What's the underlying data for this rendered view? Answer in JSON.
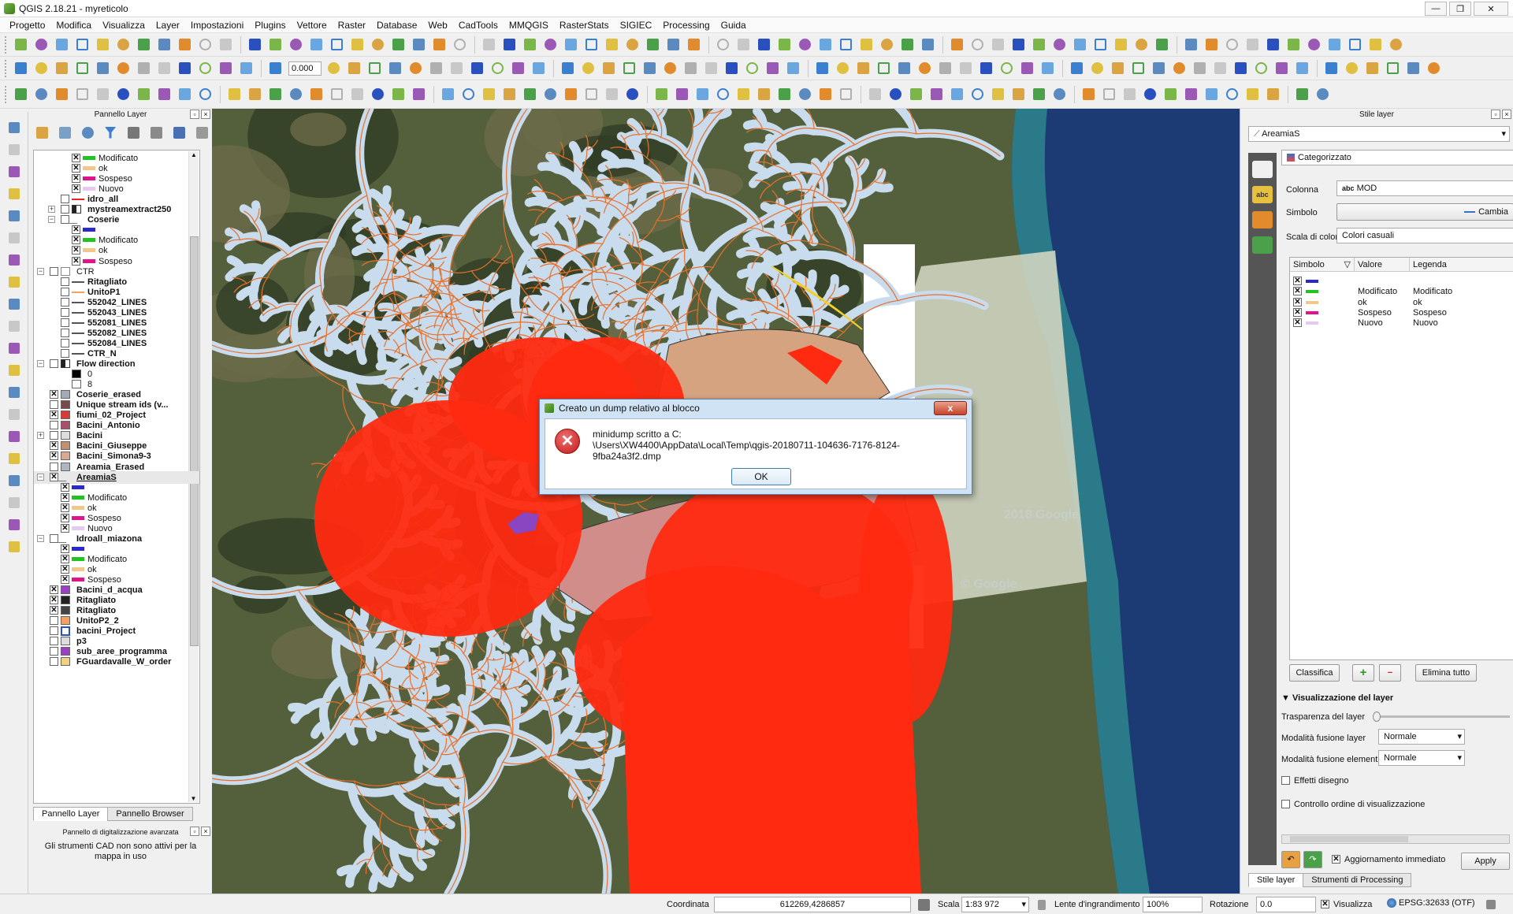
{
  "window": {
    "title": "QGIS 2.18.21 - myreticolo",
    "min": "—",
    "max": "❐",
    "close": "✕"
  },
  "menu": [
    "Progetto",
    "Modifica",
    "Visualizza",
    "Layer",
    "Impostazioni",
    "Plugins",
    "Vettore",
    "Raster",
    "Database",
    "Web",
    "CadTools",
    "MMQGIS",
    "RasterStats",
    "SIGIEC",
    "Processing",
    "Guida"
  ],
  "toolbar": {
    "stroke_value": "0.000"
  },
  "layer_panel": {
    "title": "Pannello Layer",
    "tabs": [
      "Pannello Layer",
      "Pannello Browser"
    ]
  },
  "layers": [
    {
      "level": 2,
      "cb": true,
      "sym": "#22c222",
      "name": "Modificato",
      "cls": true
    },
    {
      "level": 2,
      "cb": true,
      "sym": "#f2c88a",
      "name": "ok",
      "cls": true
    },
    {
      "level": 2,
      "cb": true,
      "sym": "#e0158a",
      "name": "Sospeso",
      "cls": true
    },
    {
      "level": 2,
      "cb": true,
      "sym": "#e6c9f0",
      "name": "Nuovo",
      "cls": true
    },
    {
      "level": 1,
      "cb": false,
      "sym": "#ee2222",
      "name": "idro_all"
    },
    {
      "level": 1,
      "exp": "+",
      "cb": false,
      "sym": "raster",
      "name": "mystreamextract250"
    },
    {
      "level": 1,
      "exp": "−",
      "cb": false,
      "sym": "line",
      "name": "Coserie"
    },
    {
      "level": 2,
      "cb": true,
      "sym": "#2a2acc",
      "name": "",
      "cls": true
    },
    {
      "level": 2,
      "cb": true,
      "sym": "#22c222",
      "name": "Modificato",
      "cls": true
    },
    {
      "level": 2,
      "cb": true,
      "sym": "#f2c88a",
      "name": "ok",
      "cls": true
    },
    {
      "level": 2,
      "cb": true,
      "sym": "#e0158a",
      "name": "Sospeso",
      "cls": true
    },
    {
      "level": 0,
      "exp": "−",
      "cb": false,
      "sym": "group",
      "name": "CTR",
      "cls": true
    },
    {
      "level": 1,
      "cb": false,
      "sym": "#555",
      "name": "Ritagliato"
    },
    {
      "level": 1,
      "cb": false,
      "sym": "#f6a060",
      "name": "UnitoP1"
    },
    {
      "level": 1,
      "cb": false,
      "sym": "#555",
      "name": "552042_LINES"
    },
    {
      "level": 1,
      "cb": false,
      "sym": "#555",
      "name": "552043_LINES"
    },
    {
      "level": 1,
      "cb": false,
      "sym": "#555",
      "name": "552081_LINES"
    },
    {
      "level": 1,
      "cb": false,
      "sym": "#555",
      "name": "552082_LINES"
    },
    {
      "level": 1,
      "cb": false,
      "sym": "#555",
      "name": "552084_LINES"
    },
    {
      "level": 1,
      "cb": false,
      "sym": "#555",
      "name": "CTR_N"
    },
    {
      "level": 0,
      "exp": "−",
      "cb": false,
      "sym": "raster",
      "name": "Flow direction"
    },
    {
      "level": 1,
      "cb": null,
      "sym": "#000",
      "name": "0",
      "cls": true
    },
    {
      "level": 1,
      "cb": null,
      "sym": "#fff",
      "name": "8",
      "cls": true
    },
    {
      "level": 0,
      "cb": true,
      "sym": "#a6aab5",
      "name": "Coserie_erased"
    },
    {
      "level": 0,
      "cb": false,
      "sym": "#7a4a4a",
      "name": "Unique stream ids (v..."
    },
    {
      "level": 0,
      "cb": true,
      "sym": "#d83a3a",
      "name": "fiumi_02_Project"
    },
    {
      "level": 0,
      "cb": false,
      "sym": "#a8506a",
      "name": "Bacini_Antonio"
    },
    {
      "level": 0,
      "exp": "+",
      "cb": false,
      "sym": "#dddddd",
      "name": "Bacini"
    },
    {
      "level": 0,
      "cb": true,
      "sym": "#c09070",
      "name": "Bacini_Giuseppe"
    },
    {
      "level": 0,
      "cb": true,
      "sym": "#d8a890",
      "name": "Bacini_Simona9-3"
    },
    {
      "level": 0,
      "cb": false,
      "sym": "#b0b6be",
      "name": "Areamia_Erased"
    },
    {
      "level": 0,
      "exp": "−",
      "cb": true,
      "sym": "line",
      "name": "AreamiaS",
      "sel": true
    },
    {
      "level": 1,
      "cb": true,
      "sym": "#2a2acc",
      "name": "",
      "cls": true
    },
    {
      "level": 1,
      "cb": true,
      "sym": "#22c222",
      "name": "Modificato",
      "cls": true
    },
    {
      "level": 1,
      "cb": true,
      "sym": "#f2c88a",
      "name": "ok",
      "cls": true
    },
    {
      "level": 1,
      "cb": true,
      "sym": "#e0158a",
      "name": "Sospeso",
      "cls": true
    },
    {
      "level": 1,
      "cb": true,
      "sym": "#e6c9f0",
      "name": "Nuovo",
      "cls": true
    },
    {
      "level": 0,
      "exp": "−",
      "cb": false,
      "sym": "line",
      "name": "Idroall_miazona"
    },
    {
      "level": 1,
      "cb": true,
      "sym": "#2a2acc",
      "name": "",
      "cls": true
    },
    {
      "level": 1,
      "cb": true,
      "sym": "#22c222",
      "name": "Modificato",
      "cls": true
    },
    {
      "level": 1,
      "cb": true,
      "sym": "#f2c88a",
      "name": "ok",
      "cls": true
    },
    {
      "level": 1,
      "cb": true,
      "sym": "#e0158a",
      "name": "Sospeso",
      "cls": true
    },
    {
      "level": 0,
      "cb": true,
      "sym": "#9b3fc4",
      "name": "Bacini_d_acqua"
    },
    {
      "level": 0,
      "cb": true,
      "sym": "#222",
      "name": "Ritagliato"
    },
    {
      "level": 0,
      "cb": true,
      "sym": "#444",
      "name": "Ritagliato"
    },
    {
      "level": 0,
      "cb": false,
      "sym": "#f6a060",
      "name": "UnitoP2_2"
    },
    {
      "level": 0,
      "cb": false,
      "sym": "outline",
      "name": "bacini_Project"
    },
    {
      "level": 0,
      "cb": false,
      "sym": "#ddd",
      "name": "p3"
    },
    {
      "level": 0,
      "cb": false,
      "sym": "#9b3fc4",
      "name": "sub_aree_programma"
    },
    {
      "level": 0,
      "cb": false,
      "sym": "#f2d080",
      "name": "FGuardavalle_W_order"
    }
  ],
  "adv_panel": {
    "title": "Pannello di digitalizzazione avanzata",
    "text": "Gli strumenti CAD non sono attivi per la mappa in uso"
  },
  "style_panel": {
    "title": "Stile layer",
    "layer": "AreamiaS",
    "renderer": "Categorizzato",
    "column_label": "Colonna",
    "column_value": "MOD",
    "column_prefix": "abc",
    "symbol_label": "Simbolo",
    "change_label": "Cambia",
    "ramp_label": "Scala di colori",
    "ramp_value": "Colori casuali",
    "headers": [
      "Simbolo",
      "Valore",
      "Legenda"
    ],
    "rows": [
      {
        "color": "#2a2acc",
        "value": "",
        "legend": ""
      },
      {
        "color": "#22c222",
        "value": "Modificato",
        "legend": "Modificato"
      },
      {
        "color": "#f2c88a",
        "value": "ok",
        "legend": "ok"
      },
      {
        "color": "#e0158a",
        "value": "Sospeso",
        "legend": "Sospeso"
      },
      {
        "color": "#e6c9f0",
        "value": "Nuovo",
        "legend": "Nuovo"
      }
    ],
    "classify": "Classifica",
    "delete_all": "Elimina tutto",
    "rendering_title": "Visualizzazione del layer",
    "transparency": "Trasparenza del layer",
    "blend_layer": "Modalità fusione layer",
    "blend_layer_val": "Normale",
    "blend_elem": "Modalità fusione elementi",
    "blend_elem_val": "Normale",
    "effects": "Effetti disegno",
    "order": "Controllo ordine di visualizzazione",
    "live_update": "Aggiornamento immediato",
    "apply": "Apply",
    "tabs": [
      "Stile layer",
      "Strumenti di Processing"
    ]
  },
  "dialog": {
    "title": "Creato un dump relativo al blocco",
    "close": "x",
    "line1": "minidump scritto a C:",
    "line2": "\\Users\\XW4400\\AppData\\Local\\Temp\\qgis-20180711-104636-7176-8124-9fba24a3f2.dmp",
    "ok": "OK"
  },
  "status": {
    "coord_label": "Coordinata",
    "coord": "612269,4286857",
    "scale_label": "Scala",
    "scale": "1:83 972",
    "mag_label": "Lente d'ingrandimento",
    "mag": "100%",
    "rot_label": "Rotazione",
    "rot": "0.0",
    "render": "Visualizza",
    "crs": "EPSG:32633 (OTF)"
  },
  "map": {
    "watermark1": "2018 Google",
    "watermark2": "© Google"
  }
}
